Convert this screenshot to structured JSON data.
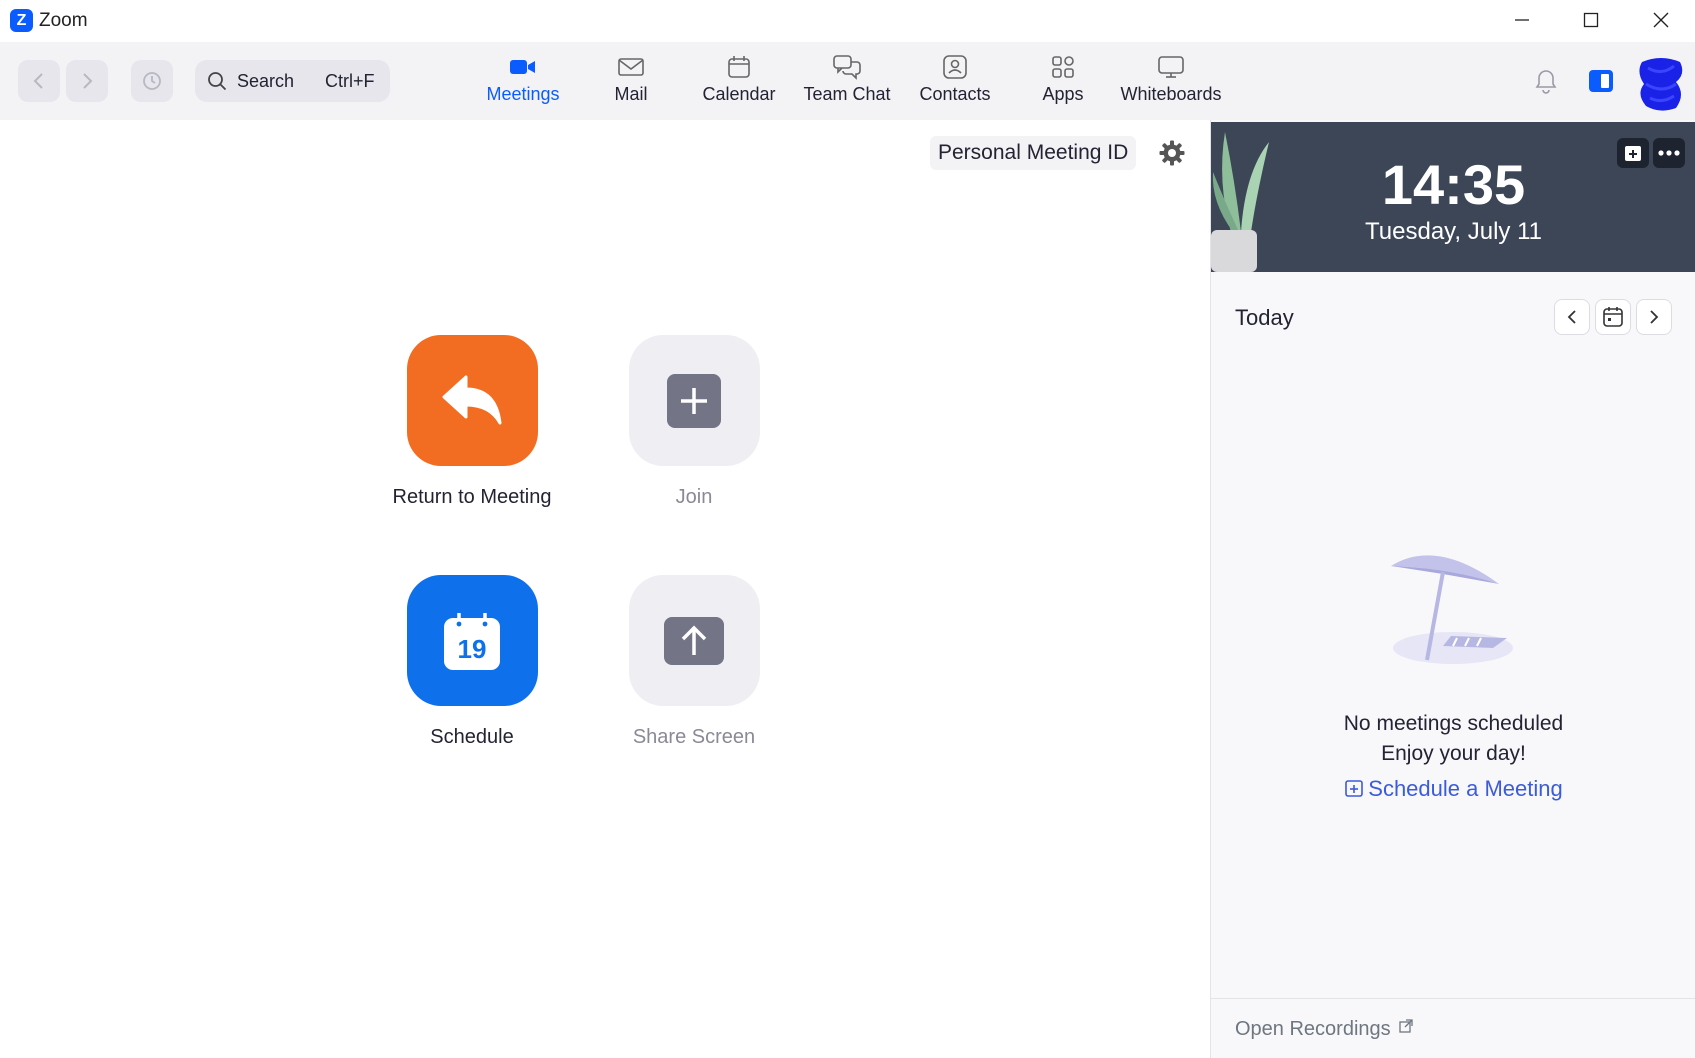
{
  "window": {
    "title": "Zoom",
    "logo_letter": "Z"
  },
  "search": {
    "label": "Search",
    "shortcut": "Ctrl+F"
  },
  "tabs": [
    {
      "label": "Meetings",
      "icon": "video-camera-icon",
      "active": true
    },
    {
      "label": "Mail",
      "icon": "mail-icon",
      "active": false
    },
    {
      "label": "Calendar",
      "icon": "calendar-icon",
      "active": false
    },
    {
      "label": "Team Chat",
      "icon": "chat-bubbles-icon",
      "active": false
    },
    {
      "label": "Contacts",
      "icon": "contact-card-icon",
      "active": false
    },
    {
      "label": "Apps",
      "icon": "apps-grid-icon",
      "active": false
    },
    {
      "label": "Whiteboards",
      "icon": "whiteboard-icon",
      "active": false
    }
  ],
  "main": {
    "personal_meeting_id": "Personal Meeting ID",
    "actions": [
      {
        "label": "Return to Meeting",
        "icon": "reply-arrow-icon",
        "color": "#f26d21",
        "enabled": true
      },
      {
        "label": "Join",
        "icon": "plus-icon",
        "color": "#efeff3",
        "enabled": false
      },
      {
        "label": "Schedule",
        "icon": "calendar-icon",
        "color": "#0e71eb",
        "enabled": true,
        "calendar_day": "19"
      },
      {
        "label": "Share Screen",
        "icon": "upload-arrow-icon",
        "color": "#efeff3",
        "enabled": false
      }
    ]
  },
  "panel": {
    "time": "14:35",
    "date": "Tuesday, July 11",
    "today_label": "Today",
    "empty_line1": "No meetings scheduled",
    "empty_line2": "Enjoy your day!",
    "schedule_link": "Schedule a Meeting",
    "open_recordings": "Open Recordings"
  },
  "colors": {
    "accent": "#0b5cff",
    "orange": "#f26d21",
    "schedule_blue": "#0e71eb",
    "link": "#3b5bdb"
  }
}
